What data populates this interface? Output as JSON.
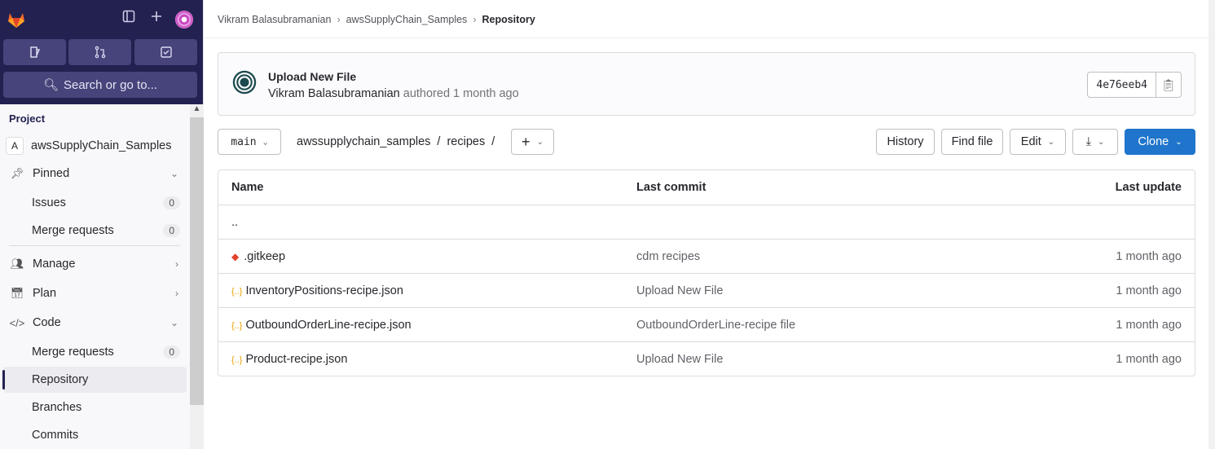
{
  "sidebar": {
    "search_label": "Search or go to...",
    "section_title": "Project",
    "project_initial": "A",
    "project_name": "awsSupplyChain_Samples",
    "items": [
      {
        "label": "Pinned"
      },
      {
        "label": "Issues",
        "count": "0"
      },
      {
        "label": "Merge requests",
        "count": "0"
      },
      {
        "label": "Manage"
      },
      {
        "label": "Plan"
      },
      {
        "label": "Code"
      },
      {
        "label": "Merge requests",
        "count": "0"
      },
      {
        "label": "Repository"
      },
      {
        "label": "Branches"
      },
      {
        "label": "Commits"
      }
    ]
  },
  "breadcrumb": [
    "Vikram Balasubramanian",
    "awsSupplyChain_Samples",
    "Repository"
  ],
  "commit": {
    "title": "Upload New File",
    "author": "Vikram Balasubramanian",
    "meta": "authored 1 month ago",
    "sha": "4e76eeb4"
  },
  "toolbar": {
    "branch": "main",
    "path": [
      "awssupplychain_samples",
      "recipes"
    ],
    "history": "History",
    "find_file": "Find file",
    "edit": "Edit",
    "clone": "Clone",
    "accent": "#1f75cb"
  },
  "table": {
    "headers": [
      "Name",
      "Last commit",
      "Last update"
    ],
    "parent": "..",
    "rows": [
      {
        "name": ".gitkeep",
        "commit": "cdm recipes",
        "updated": "1 month ago",
        "icon": "git-icon"
      },
      {
        "name": "InventoryPositions-recipe.json",
        "commit": "Upload New File",
        "updated": "1 month ago",
        "icon": "json-icon"
      },
      {
        "name": "OutboundOrderLine-recipe.json",
        "commit": "OutboundOrderLine-recipe file",
        "updated": "1 month ago",
        "icon": "json-icon"
      },
      {
        "name": "Product-recipe.json",
        "commit": "Upload New File",
        "updated": "1 month ago",
        "icon": "json-icon"
      }
    ]
  }
}
